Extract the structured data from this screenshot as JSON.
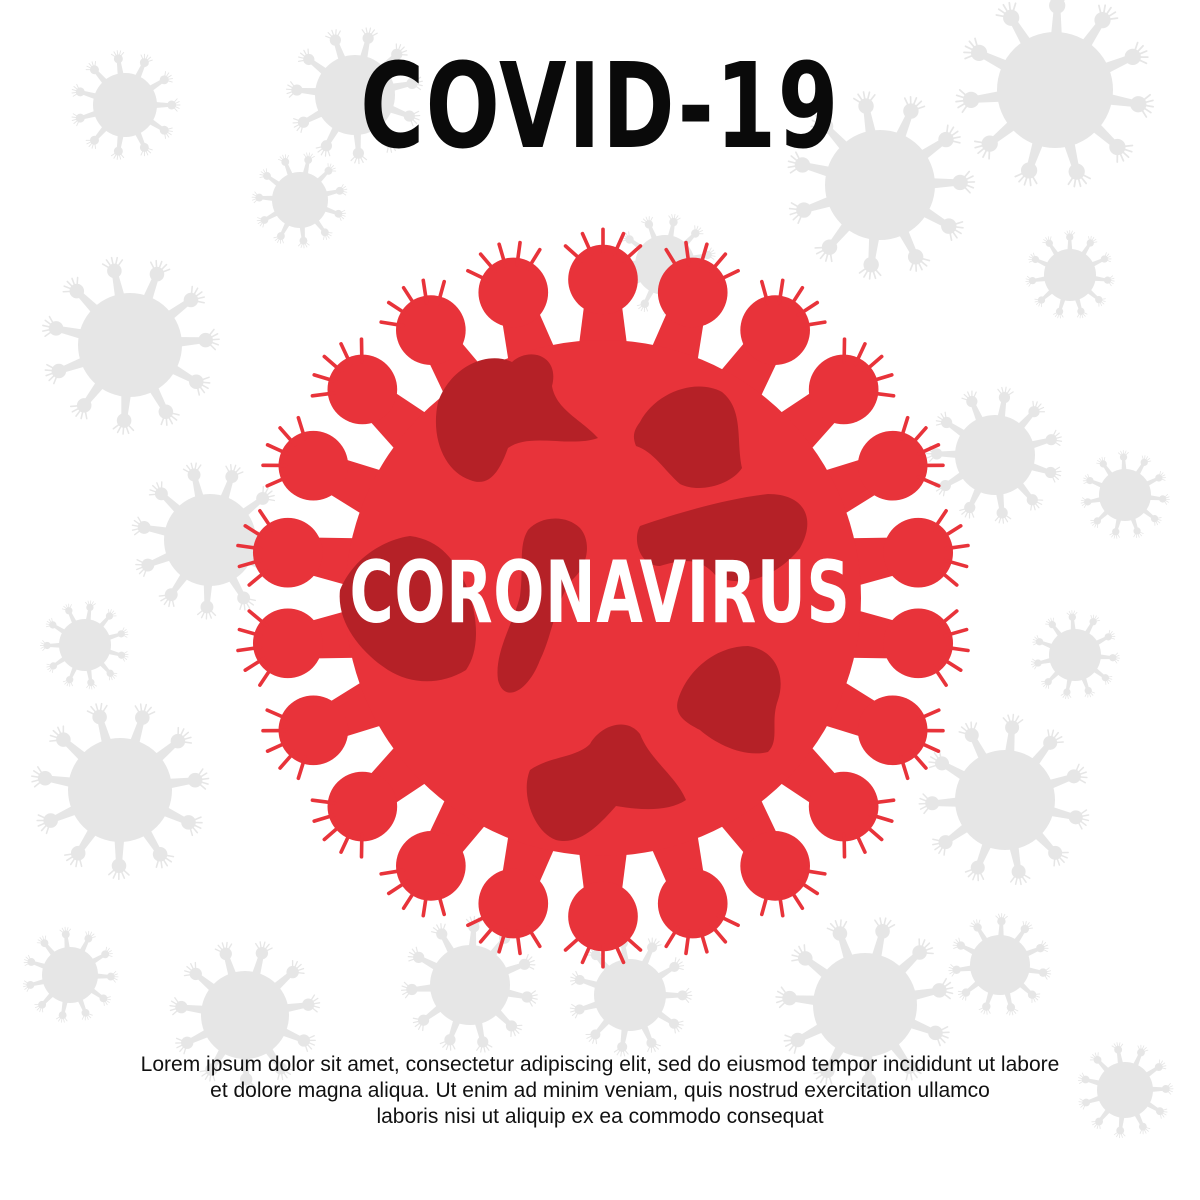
{
  "poster": {
    "headline": "COVID-19",
    "virus_label": "CORONAVIRUS",
    "body_lines": [
      "Lorem ipsum dolor sit amet, consectetur adipiscing elit, sed do eiusmod tempor incididunt ut labore",
      "et dolore magna aliqua. Ut enim ad minim veniam, quis nostrud exercitation ullamco",
      "laboris nisi ut aliquip ex ea commodo consequat"
    ]
  },
  "colors": {
    "background": "#ffffff",
    "virus_red": "#e8333a",
    "virus_dark_red": "#b52127",
    "background_virus_gray": "#e6e6e6",
    "headline": "#0a0a0a",
    "label": "#ffffff"
  },
  "icons": {
    "main": "coronavirus-icon",
    "background": "virus-particle-icon"
  }
}
